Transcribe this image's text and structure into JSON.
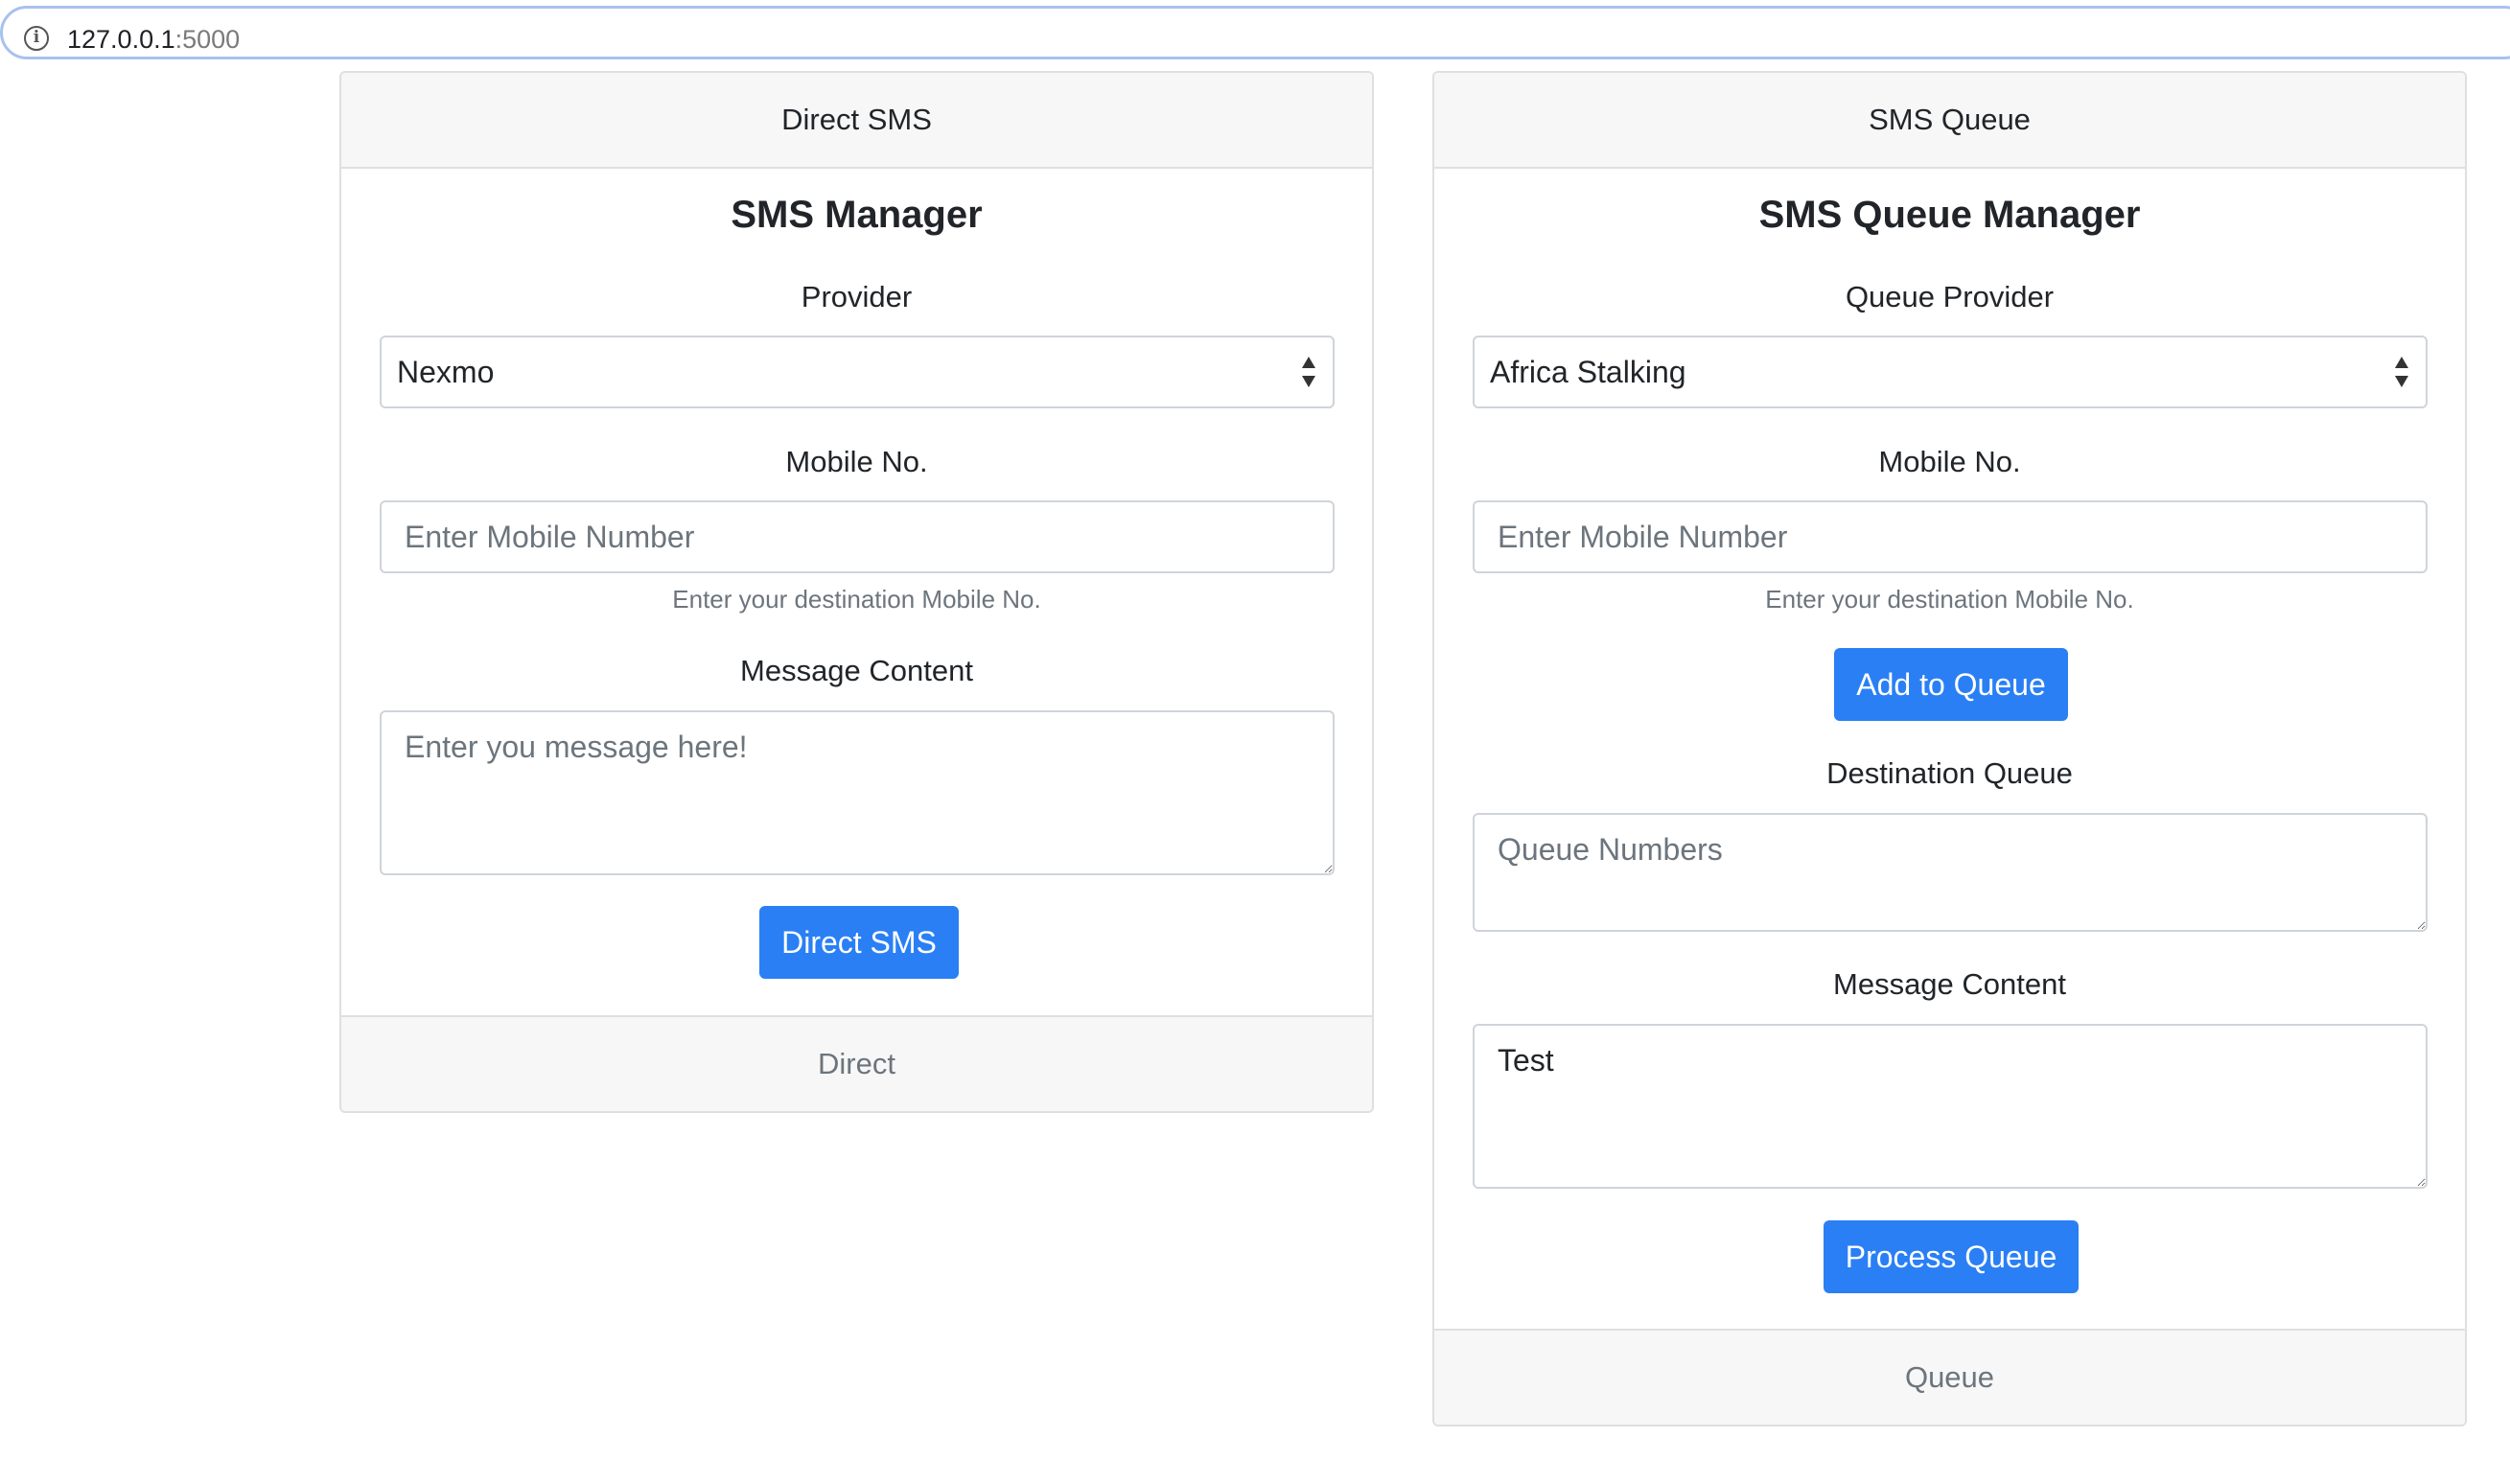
{
  "browser": {
    "url_host": "127.0.0.1",
    "url_port": ":5000",
    "info_icon": "i"
  },
  "direct_card": {
    "header": "Direct SMS",
    "title": "SMS Manager",
    "provider_label": "Provider",
    "provider_selected": "Nexmo",
    "mobile_label": "Mobile No.",
    "mobile_placeholder": "Enter Mobile Number",
    "mobile_help": "Enter your destination Mobile No.",
    "message_label": "Message Content",
    "message_placeholder": "Enter you message here!",
    "submit_label": "Direct SMS",
    "footer": "Direct"
  },
  "queue_card": {
    "header": "SMS Queue",
    "title": "SMS Queue Manager",
    "provider_label": "Queue Provider",
    "provider_selected": "Africa Stalking",
    "mobile_label": "Mobile No.",
    "mobile_placeholder": "Enter Mobile Number",
    "mobile_help": "Enter your destination Mobile No.",
    "add_button_label": "Add to Queue",
    "destination_label": "Destination Queue",
    "destination_placeholder": "Queue Numbers",
    "message_label": "Message Content",
    "message_value": "Test",
    "process_button_label": "Process Queue",
    "footer": "Queue"
  },
  "colors": {
    "primary_button": "#2a7ff5",
    "card_header_bg": "#f7f7f7"
  }
}
